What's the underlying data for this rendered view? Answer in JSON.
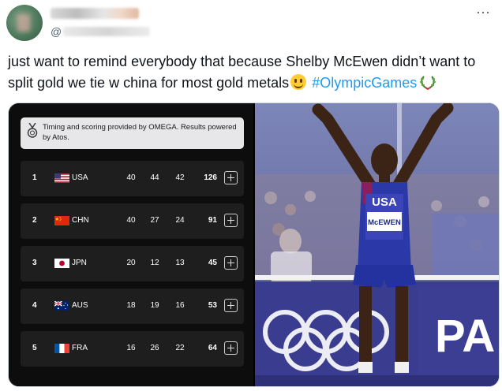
{
  "tweet": {
    "handle_prefix": "@",
    "text_main": "just want to remind everybody that because Shelby McEwen didn’t want to split gold we tie w china for most gold metals",
    "hashtag": "#OlympicGames",
    "emoji_name": "grinning-face-icon",
    "wreath_name": "laurel-wreath-icon"
  },
  "medal_table": {
    "notice": "Timing and scoring provided by OMEGA. Results powered by Atos.",
    "rows": [
      {
        "rank": "1",
        "code": "USA",
        "gold": "40",
        "silver": "44",
        "bronze": "42",
        "total": "126"
      },
      {
        "rank": "2",
        "code": "CHN",
        "gold": "40",
        "silver": "27",
        "bronze": "24",
        "total": "91"
      },
      {
        "rank": "3",
        "code": "JPN",
        "gold": "20",
        "silver": "12",
        "bronze": "13",
        "total": "45"
      },
      {
        "rank": "4",
        "code": "AUS",
        "gold": "18",
        "silver": "19",
        "bronze": "16",
        "total": "53"
      },
      {
        "rank": "5",
        "code": "FRA",
        "gold": "16",
        "silver": "26",
        "bronze": "22",
        "total": "64"
      }
    ]
  },
  "photo": {
    "bib_country": "USA",
    "bib_name": "McEWEN",
    "board_letters": "PA"
  }
}
